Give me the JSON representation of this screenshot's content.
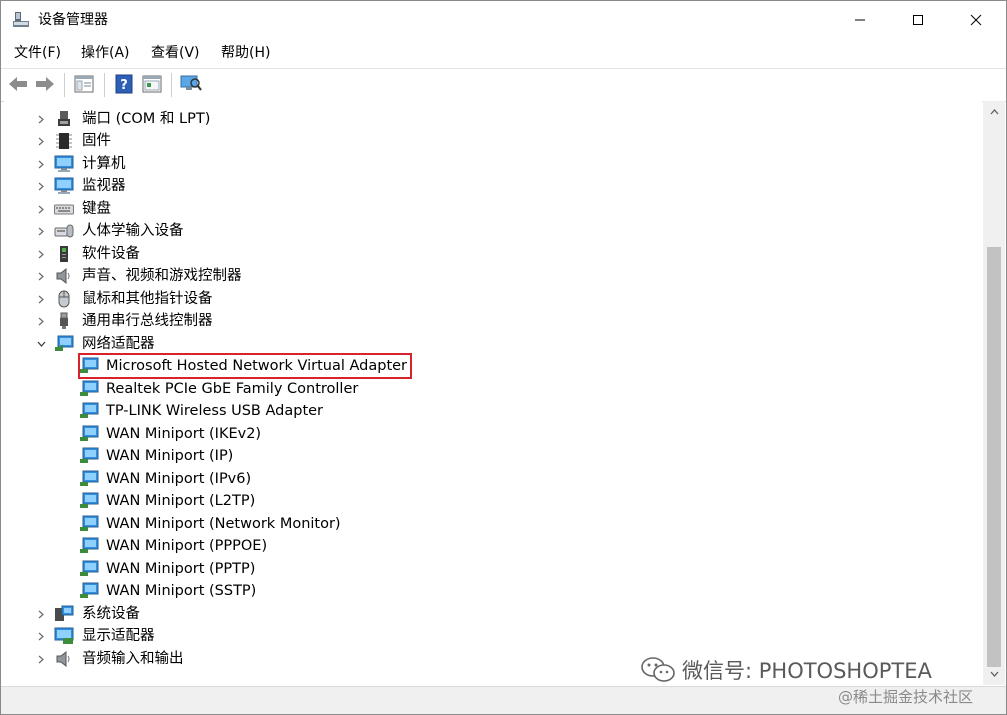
{
  "window": {
    "title": "设备管理器"
  },
  "menu": [
    {
      "label": "文件(F)"
    },
    {
      "label": "操作(A)"
    },
    {
      "label": "查看(V)"
    },
    {
      "label": "帮助(H)"
    }
  ],
  "tree": {
    "items": [
      {
        "label": "端口 (COM 和 LPT)",
        "icon": "port-icon",
        "expanded": false
      },
      {
        "label": "固件",
        "icon": "firmware-chip-icon",
        "expanded": false
      },
      {
        "label": "计算机",
        "icon": "computer-icon",
        "expanded": false
      },
      {
        "label": "监视器",
        "icon": "monitor-icon",
        "expanded": false
      },
      {
        "label": "键盘",
        "icon": "keyboard-icon",
        "expanded": false
      },
      {
        "label": "人体学输入设备",
        "icon": "hid-icon",
        "expanded": false
      },
      {
        "label": "软件设备",
        "icon": "software-device-icon",
        "expanded": false
      },
      {
        "label": "声音、视频和游戏控制器",
        "icon": "speaker-icon",
        "expanded": false
      },
      {
        "label": "鼠标和其他指针设备",
        "icon": "mouse-icon",
        "expanded": false
      },
      {
        "label": "通用串行总线控制器",
        "icon": "usb-icon",
        "expanded": false
      },
      {
        "label": "网络适配器",
        "icon": "network-adapter-icon",
        "expanded": true
      },
      {
        "label": "系统设备",
        "icon": "system-device-icon",
        "expanded": false
      },
      {
        "label": "显示适配器",
        "icon": "display-adapter-icon",
        "expanded": false
      },
      {
        "label": "音频输入和输出",
        "icon": "audio-io-icon",
        "expanded": false
      }
    ],
    "network_children": [
      {
        "label": "Microsoft Hosted Network Virtual Adapter",
        "highlighted": true
      },
      {
        "label": "Realtek PCIe GbE Family Controller"
      },
      {
        "label": "TP-LINK Wireless USB Adapter"
      },
      {
        "label": "WAN Miniport (IKEv2)"
      },
      {
        "label": "WAN Miniport (IP)"
      },
      {
        "label": "WAN Miniport (IPv6)"
      },
      {
        "label": "WAN Miniport (L2TP)"
      },
      {
        "label": "WAN Miniport (Network Monitor)"
      },
      {
        "label": "WAN Miniport (PPPOE)"
      },
      {
        "label": "WAN Miniport (PPTP)"
      },
      {
        "label": "WAN Miniport (SSTP)"
      }
    ]
  },
  "watermark": {
    "wechat": "微信号: PHOTOSHOPTEA",
    "juejin": "@稀土掘金技术社区"
  },
  "colors": {
    "highlight_border": "#d8232a",
    "accent": "#1a73c8"
  }
}
